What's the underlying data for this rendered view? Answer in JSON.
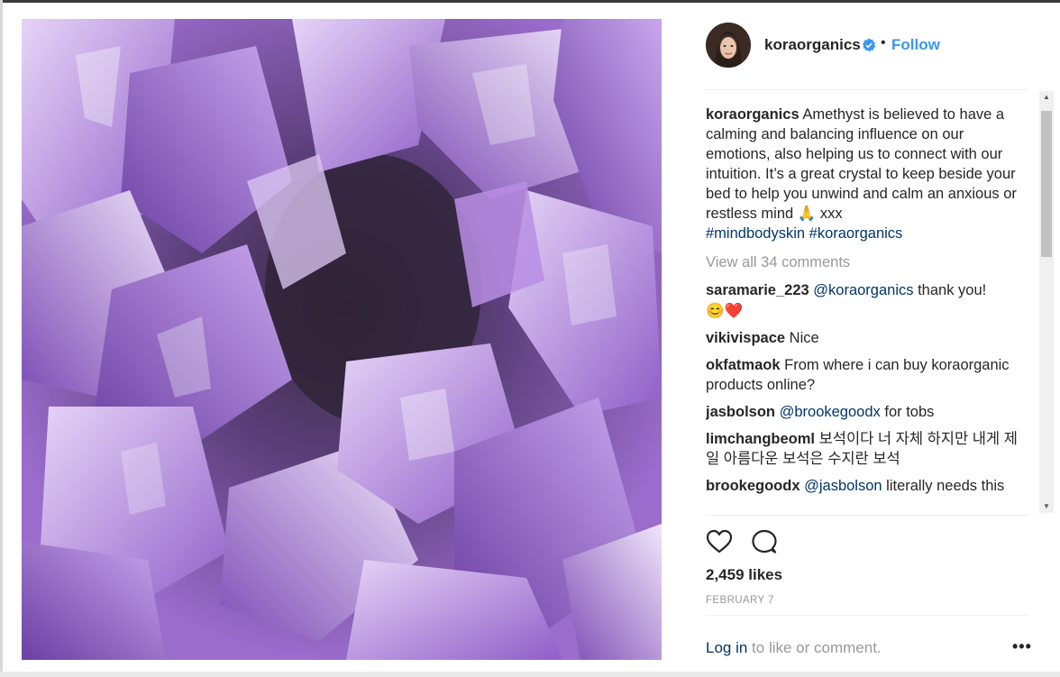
{
  "post": {
    "username": "koraorganics",
    "separator": "•",
    "follow_label": "Follow",
    "caption": {
      "username": "koraorganics",
      "text": "Amethyst is believed to have a calming and balancing influence on our emotions, also helping us to connect with our intuition. It’s a great crystal to keep beside your bed to help you unwind and calm an anxious or restless mind 🙏 xxx",
      "tags": [
        "#mindbodyskin",
        "#koraorganics"
      ]
    },
    "view_all_comments": "View all 34 comments",
    "comments": [
      {
        "user": "saramarie_223",
        "mention": "@koraorganics",
        "text": " thank you!",
        "emoji": "😊❤️"
      },
      {
        "user": "vikivispace",
        "mention": "",
        "text": " Nice"
      },
      {
        "user": "okfatmaok",
        "mention": "",
        "text": " From where i can buy koraorganic products online?"
      },
      {
        "user": "jasbolson",
        "mention": "@brookegoodx",
        "text": " for tobs"
      },
      {
        "user": "limchangbeoml",
        "mention": "",
        "text": " 보석이다 너 자체 하지만 내게 제일 아름다운 보석은 수지란 보석"
      },
      {
        "user": "brookegoodx",
        "mention": "@jasbolson",
        "text": " literally needs this"
      }
    ],
    "likes": "2,459 likes",
    "date": "FEBRUARY 7",
    "login_link": "Log in",
    "login_suffix": " to like or comment.",
    "more_label": "•••"
  },
  "icons": {
    "verified": "verified-badge-icon",
    "like": "heart-icon",
    "comment": "comment-bubble-icon",
    "more": "more-options-icon"
  },
  "colors": {
    "link_blue": "#3897f0",
    "mention_blue": "#003569",
    "muted_gray": "#999999",
    "text": "#262626"
  }
}
